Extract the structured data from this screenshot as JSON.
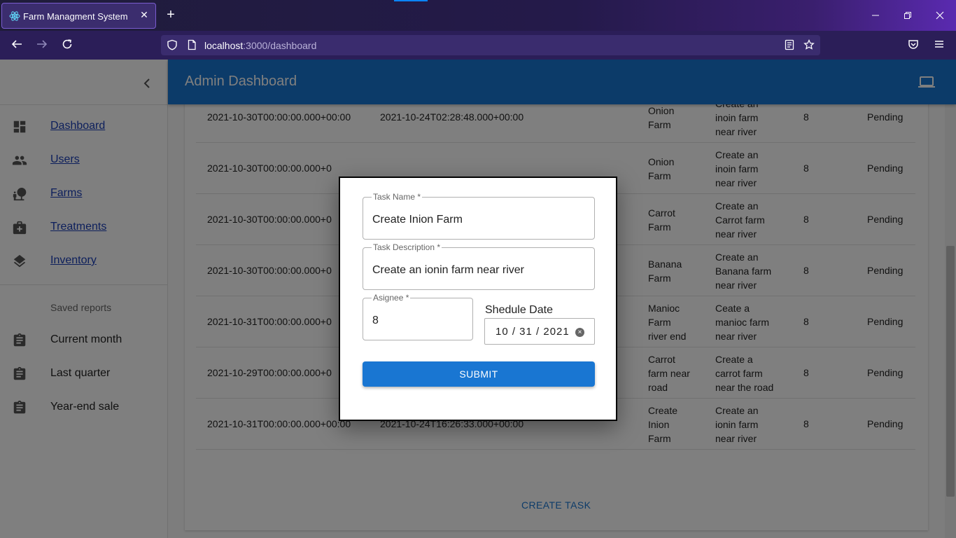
{
  "browser": {
    "tab_title": "Farm Managment System",
    "tab_close": "✕",
    "new_tab": "+",
    "url_host": "localhost",
    "url_path": ":3000/dashboard"
  },
  "app": {
    "title": "Admin Dashboard",
    "sidebar": {
      "items": [
        {
          "label": "Dashboard",
          "icon": "dashboard-icon"
        },
        {
          "label": "Users",
          "icon": "people-icon"
        },
        {
          "label": "Farms",
          "icon": "nature-people-icon"
        },
        {
          "label": "Treatments",
          "icon": "medical-bag-icon"
        },
        {
          "label": "Inventory",
          "icon": "layers-icon"
        }
      ],
      "subheader": "Saved reports",
      "reports": [
        {
          "label": "Current month",
          "icon": "assignment-icon"
        },
        {
          "label": "Last quarter",
          "icon": "assignment-icon"
        },
        {
          "label": "Year-end sale",
          "icon": "assignment-icon"
        }
      ]
    },
    "table": {
      "rows": [
        {
          "due": "2021-10-30T00:00:00.000+00:00",
          "created": "2021-10-24T02:28:48.000+00:00",
          "name": [
            "Onion",
            "Farm"
          ],
          "desc": [
            "inoin farm",
            "near river"
          ],
          "assignee": "8",
          "status": "Pending"
        },
        {
          "due": "2021-10-30T00:00:00.000+00:00",
          "created": "2021-10-24T02:28:48.000+00:00",
          "name": [
            "Onion",
            "Farm"
          ],
          "desc": [
            "Create an",
            "inoin farm",
            "near river"
          ],
          "assignee": "8",
          "status": "Pending"
        },
        {
          "due": "2021-10-30T00:00:00.000+0",
          "created": "",
          "name": [
            "Onion",
            "Farm"
          ],
          "desc": [
            "Create an",
            "inoin farm",
            "near river"
          ],
          "assignee": "8",
          "status": "Pending"
        },
        {
          "due": "2021-10-30T00:00:00.000+0",
          "created": "",
          "name": [
            "Carrot",
            "Farm"
          ],
          "desc": [
            "Create an",
            "Carrot farm",
            "near river"
          ],
          "assignee": "8",
          "status": "Pending"
        },
        {
          "due": "2021-10-30T00:00:00.000+0",
          "created": "",
          "name": [
            "Banana",
            "Farm"
          ],
          "desc": [
            "Create an",
            "Banana farm",
            "near river"
          ],
          "assignee": "8",
          "status": "Pending"
        },
        {
          "due": "2021-10-31T00:00:00.000+0",
          "created": "",
          "name": [
            "Manioc",
            "Farm",
            "river end"
          ],
          "desc": [
            "Ceate a",
            "manioc farm",
            "near river"
          ],
          "assignee": "8",
          "status": "Pending"
        },
        {
          "due": "2021-10-29T00:00:00.000+0",
          "created": "",
          "name": [
            "Carrot",
            "farm near",
            "road"
          ],
          "desc": [
            "Create a",
            "carrot farm",
            "near the road"
          ],
          "assignee": "8",
          "status": "Pending"
        },
        {
          "due": "2021-10-31T00:00:00.000+00:00",
          "created": "2021-10-24T16:26:33.000+00:00",
          "name": [
            "Create",
            "Inion",
            "Farm"
          ],
          "desc": [
            "Create an",
            "ionin farm",
            "near river"
          ],
          "assignee": "8",
          "status": "Pending"
        }
      ],
      "create_task": "CREATE TASK"
    },
    "modal": {
      "task_name_label": "Task Name *",
      "task_name_value": "Create Inion Farm",
      "task_desc_label": "Task Description *",
      "task_desc_value": "Create an ionin farm near river",
      "assignee_label": "Asignee *",
      "assignee_value": "8",
      "date_label": "Shedule Date",
      "date_value": "10 / 31 / 2021",
      "submit": "SUBMIT"
    }
  }
}
